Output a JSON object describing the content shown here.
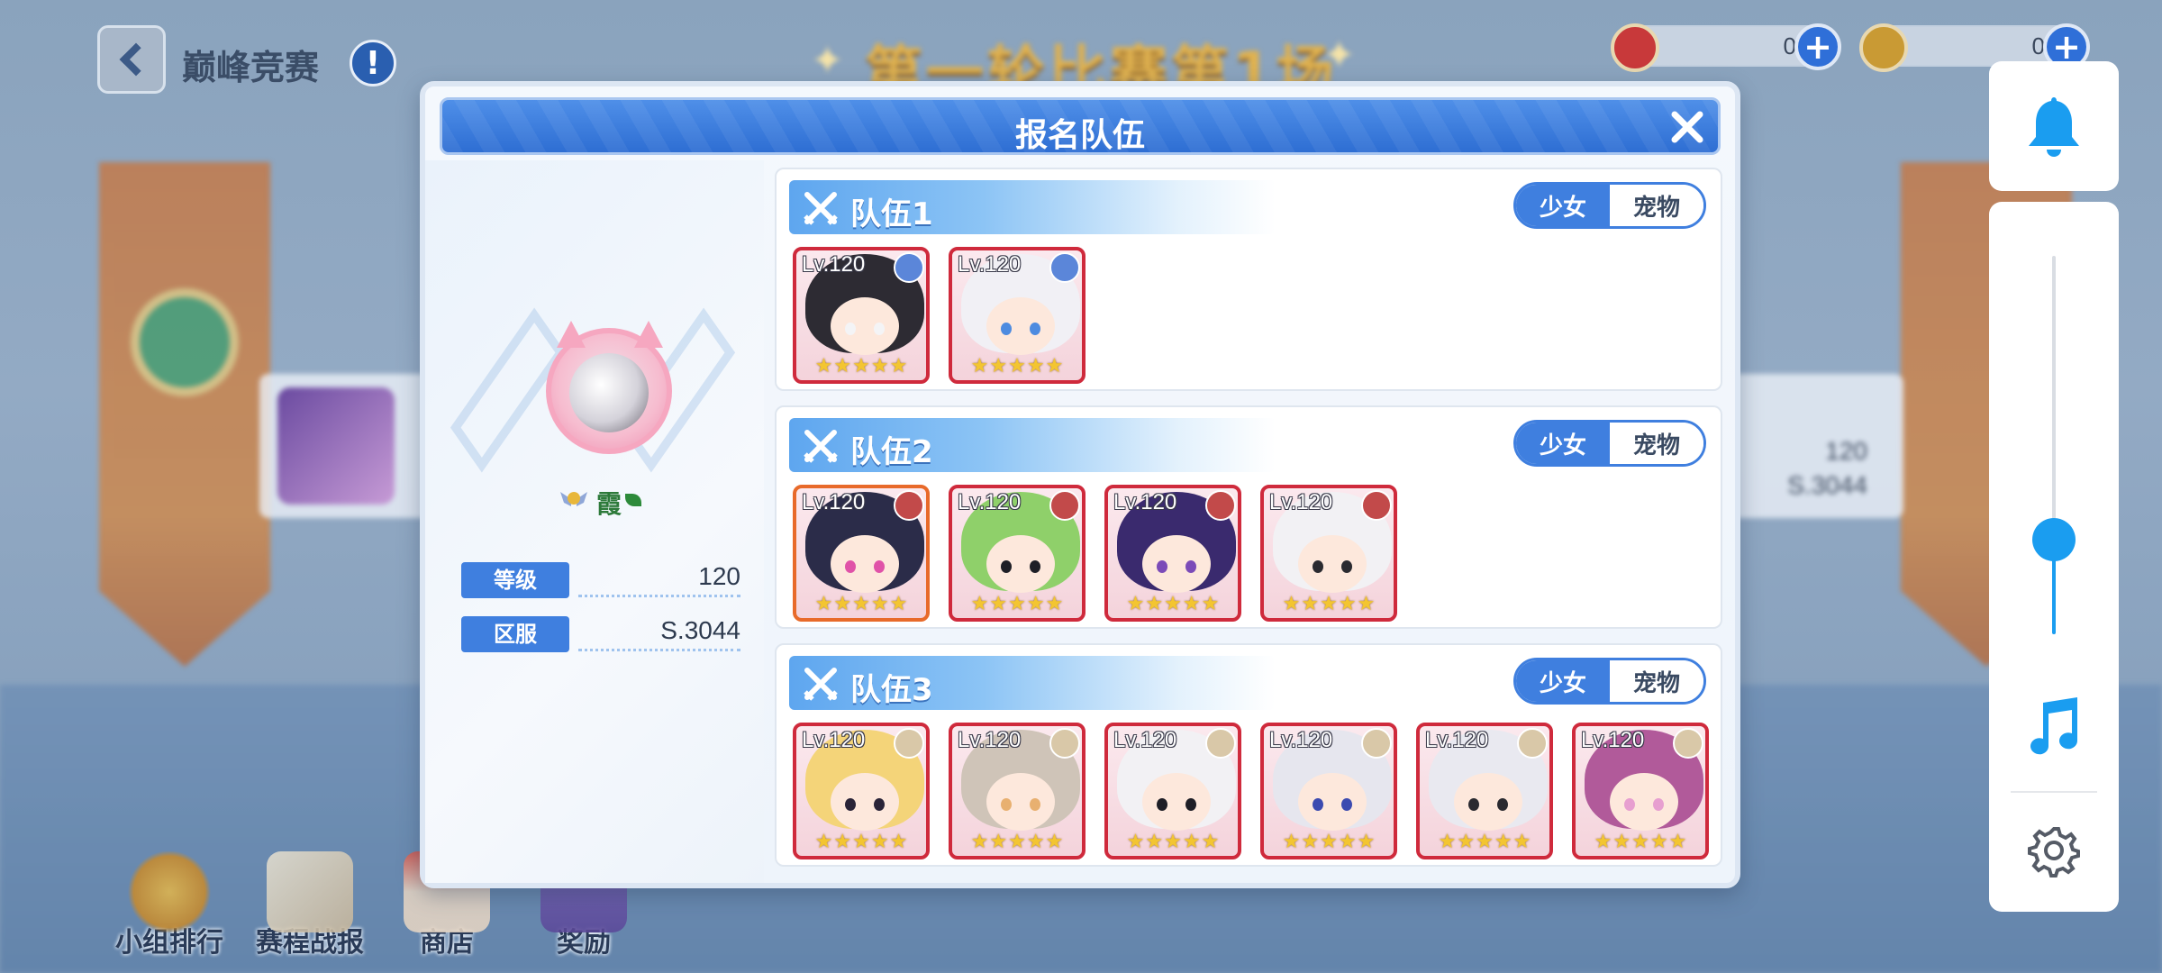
{
  "header": {
    "title": "巅峰竞赛",
    "banner_text": "第一轮比赛第1场",
    "currencies": [
      {
        "icon": "red-medal-coin-icon",
        "value": "0",
        "color": "#c8393a"
      },
      {
        "icon": "gold-coin-icon",
        "value": "0",
        "color": "#c99a34"
      }
    ]
  },
  "background_card": {
    "level": "120",
    "server": "S.3044"
  },
  "bottom_nav": [
    {
      "label": "小组排行",
      "icon": "medal-icon"
    },
    {
      "label": "赛程战报",
      "icon": "scroll-icon"
    },
    {
      "label": "商店",
      "icon": "shop-icon"
    },
    {
      "label": "奖励",
      "icon": "reward-bag-icon"
    }
  ],
  "side_panel": {
    "icons": [
      "bell-icon",
      "music-note-icon",
      "settings-gear-icon"
    ],
    "volume_level": 0.25
  },
  "modal": {
    "title": "报名队伍",
    "profile": {
      "name": "霞",
      "level_label": "等级",
      "level_value": "120",
      "server_label": "区服",
      "server_value": "S.3044"
    },
    "teams": [
      {
        "name": "队伍1",
        "toggle": {
          "girl": "少女",
          "pet": "宠物",
          "selected": "少女"
        },
        "members": [
          {
            "level": "Lv.120",
            "stars": 5,
            "badge": "crown-badge",
            "hair": "#2d2b33",
            "accent": "#f4f4f6",
            "frame": "red"
          },
          {
            "level": "Lv.120",
            "stars": 5,
            "badge": "crown-badge",
            "hair": "#f1f0f5",
            "accent": "#4d8be0",
            "frame": "red"
          }
        ]
      },
      {
        "name": "队伍2",
        "toggle": {
          "girl": "少女",
          "pet": "宠物",
          "selected": "少女"
        },
        "members": [
          {
            "level": "Lv.120",
            "stars": 5,
            "badge": "rose-badge",
            "hair": "#2b2c49",
            "accent": "#e052a8",
            "frame": "orange"
          },
          {
            "level": "Lv.120",
            "stars": 5,
            "badge": "rose-badge",
            "hair": "#8fd06a",
            "accent": "#1e1e26",
            "frame": "red"
          },
          {
            "level": "Lv.120",
            "stars": 5,
            "badge": "rose-badge",
            "hair": "#3a2a6e",
            "accent": "#7b4bb8",
            "frame": "red"
          },
          {
            "level": "Lv.120",
            "stars": 5,
            "badge": "rose-badge",
            "hair": "#f2f1f4",
            "accent": "#2a2a30",
            "frame": "red"
          }
        ]
      },
      {
        "name": "队伍3",
        "toggle": {
          "girl": "少女",
          "pet": "宠物",
          "selected": "少女"
        },
        "members": [
          {
            "level": "Lv.120",
            "stars": 5,
            "badge": "gear-badge",
            "hair": "#f4d479",
            "accent": "#2a2438",
            "frame": "red"
          },
          {
            "level": "Lv.120",
            "stars": 5,
            "badge": "gear-badge",
            "hair": "#cfc4b8",
            "accent": "#e8b070",
            "frame": "red"
          },
          {
            "level": "Lv.120",
            "stars": 5,
            "badge": "gear-badge",
            "hair": "#f2f1f4",
            "accent": "#1e1e26",
            "frame": "red"
          },
          {
            "level": "Lv.120",
            "stars": 5,
            "badge": "gear-badge",
            "hair": "#e6e6ee",
            "accent": "#3b4ab0",
            "frame": "red"
          },
          {
            "level": "Lv.120",
            "stars": 5,
            "badge": "gear-badge",
            "hair": "#e9e9f0",
            "accent": "#2a2a30",
            "frame": "red"
          },
          {
            "level": "Lv.120",
            "stars": 5,
            "badge": "gear-badge",
            "hair": "#b15a9a",
            "accent": "#e79fd0",
            "frame": "red"
          }
        ]
      }
    ]
  }
}
